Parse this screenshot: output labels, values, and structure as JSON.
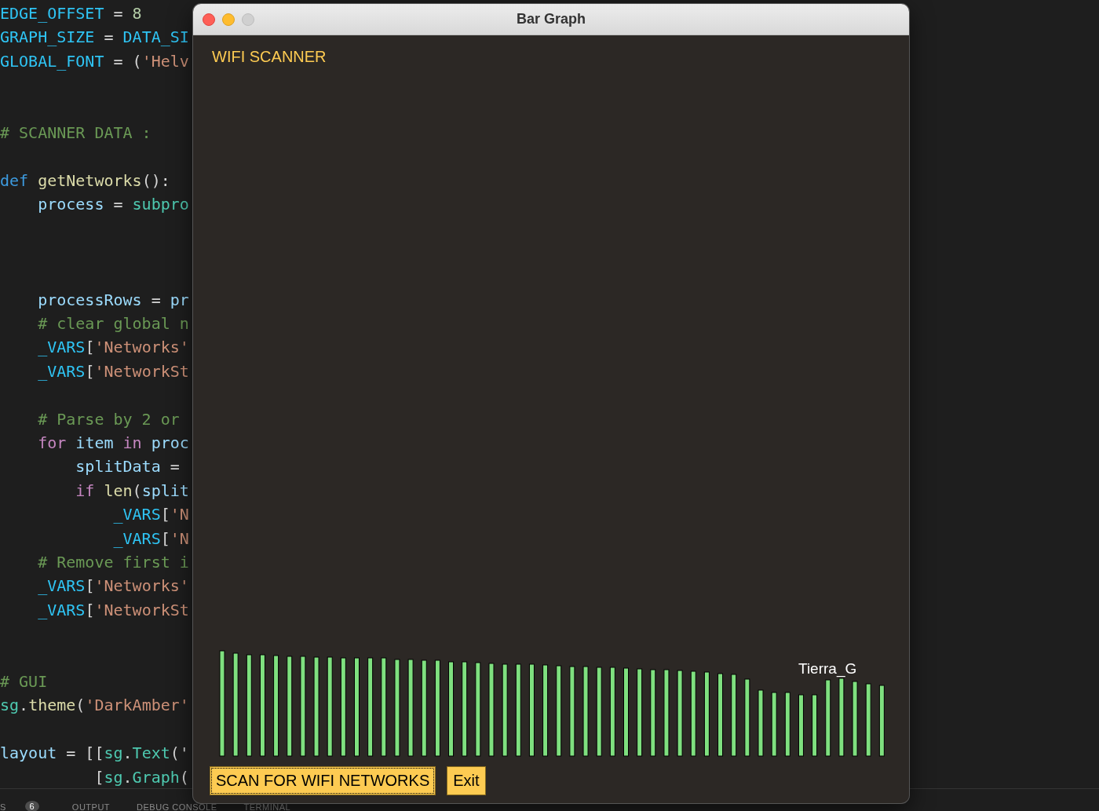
{
  "editor": {
    "lines": [
      {
        "kind": "code",
        "tokens": [
          {
            "text": "EDGE_OFFSET",
            "kind": "const"
          },
          {
            "text": " = ",
            "kind": "plain"
          },
          {
            "text": "8",
            "kind": "number"
          }
        ]
      },
      {
        "kind": "code",
        "tokens": [
          {
            "text": "GRAPH_SIZE",
            "kind": "const"
          },
          {
            "text": " = ",
            "kind": "plain"
          },
          {
            "text": "DATA_SI",
            "kind": "const"
          }
        ]
      },
      {
        "kind": "code",
        "tokens": [
          {
            "text": "GLOBAL_FONT",
            "kind": "const"
          },
          {
            "text": " = (",
            "kind": "plain"
          },
          {
            "text": "'Helv",
            "kind": "string"
          }
        ]
      },
      {
        "kind": "blank"
      },
      {
        "kind": "blank"
      },
      {
        "kind": "code",
        "tokens": [
          {
            "text": "# SCANNER DATA :",
            "kind": "comment"
          }
        ]
      },
      {
        "kind": "blank"
      },
      {
        "kind": "code",
        "tokens": [
          {
            "text": "def",
            "kind": "keyword"
          },
          {
            "text": " getNetworks",
            "kind": "function"
          },
          {
            "text": "():",
            "kind": "plain"
          }
        ]
      },
      {
        "kind": "code",
        "tokens": [
          {
            "text": "    process",
            "kind": "variable"
          },
          {
            "text": " = ",
            "kind": "plain"
          },
          {
            "text": "subpro",
            "kind": "module"
          }
        ]
      },
      {
        "kind": "blank"
      },
      {
        "kind": "blank"
      },
      {
        "kind": "blank"
      },
      {
        "kind": "code",
        "tokens": [
          {
            "text": "    processRows",
            "kind": "variable"
          },
          {
            "text": " = ",
            "kind": "plain"
          },
          {
            "text": "pr",
            "kind": "variable"
          }
        ]
      },
      {
        "kind": "code",
        "tokens": [
          {
            "text": "    # clear global n",
            "kind": "comment"
          }
        ]
      },
      {
        "kind": "code",
        "tokens": [
          {
            "text": "    _VARS",
            "kind": "const"
          },
          {
            "text": "[",
            "kind": "plain"
          },
          {
            "text": "'Networks'",
            "kind": "string"
          }
        ]
      },
      {
        "kind": "code",
        "tokens": [
          {
            "text": "    _VARS",
            "kind": "const"
          },
          {
            "text": "[",
            "kind": "plain"
          },
          {
            "text": "'NetworkSt",
            "kind": "string"
          }
        ]
      },
      {
        "kind": "blank"
      },
      {
        "kind": "code",
        "tokens": [
          {
            "text": "    # Parse by 2 or",
            "kind": "comment"
          }
        ]
      },
      {
        "kind": "code",
        "tokens": [
          {
            "text": "    for",
            "kind": "control"
          },
          {
            "text": " item ",
            "kind": "variable"
          },
          {
            "text": "in",
            "kind": "control"
          },
          {
            "text": " proc",
            "kind": "variable"
          }
        ]
      },
      {
        "kind": "code",
        "tokens": [
          {
            "text": "        splitData",
            "kind": "variable"
          },
          {
            "text": " =",
            "kind": "plain"
          }
        ]
      },
      {
        "kind": "code",
        "tokens": [
          {
            "text": "        if",
            "kind": "control"
          },
          {
            "text": " len",
            "kind": "function"
          },
          {
            "text": "(",
            "kind": "plain"
          },
          {
            "text": "split",
            "kind": "variable"
          }
        ]
      },
      {
        "kind": "code",
        "tokens": [
          {
            "text": "            _VARS",
            "kind": "const"
          },
          {
            "text": "[",
            "kind": "plain"
          },
          {
            "text": "'N",
            "kind": "string"
          }
        ]
      },
      {
        "kind": "code",
        "tokens": [
          {
            "text": "            _VARS",
            "kind": "const"
          },
          {
            "text": "[",
            "kind": "plain"
          },
          {
            "text": "'N",
            "kind": "string"
          }
        ]
      },
      {
        "kind": "code",
        "tokens": [
          {
            "text": "    # Remove first i",
            "kind": "comment"
          }
        ]
      },
      {
        "kind": "code",
        "tokens": [
          {
            "text": "    _VARS",
            "kind": "const"
          },
          {
            "text": "[",
            "kind": "plain"
          },
          {
            "text": "'Networks'",
            "kind": "string"
          }
        ]
      },
      {
        "kind": "code",
        "tokens": [
          {
            "text": "    _VARS",
            "kind": "const"
          },
          {
            "text": "[",
            "kind": "plain"
          },
          {
            "text": "'NetworkSt",
            "kind": "string"
          }
        ]
      },
      {
        "kind": "blank"
      },
      {
        "kind": "blank"
      },
      {
        "kind": "code",
        "tokens": [
          {
            "text": "# GUI",
            "kind": "comment"
          }
        ]
      },
      {
        "kind": "code",
        "tokens": [
          {
            "text": "sg",
            "kind": "module"
          },
          {
            "text": ".",
            "kind": "plain"
          },
          {
            "text": "theme",
            "kind": "function"
          },
          {
            "text": "(",
            "kind": "plain"
          },
          {
            "text": "'DarkAmber'",
            "kind": "string"
          }
        ]
      },
      {
        "kind": "blank"
      },
      {
        "kind": "code",
        "tokens": [
          {
            "text": "layout",
            "kind": "variable"
          },
          {
            "text": " = [[",
            "kind": "plain"
          },
          {
            "text": "sg",
            "kind": "module"
          },
          {
            "text": ".",
            "kind": "plain"
          },
          {
            "text": "Text",
            "kind": "module"
          },
          {
            "text": "('",
            "kind": "plain"
          }
        ]
      },
      {
        "kind": "code",
        "tokens": [
          {
            "text": "          [",
            "kind": "plain"
          },
          {
            "text": "sg",
            "kind": "module"
          },
          {
            "text": ".",
            "kind": "plain"
          },
          {
            "text": "Graph",
            "kind": "module"
          },
          {
            "text": "(",
            "kind": "plain"
          }
        ]
      }
    ]
  },
  "panel": {
    "tabs": [
      {
        "label": "S",
        "kind": "tab"
      },
      {
        "label": "6",
        "kind": "badge"
      },
      {
        "label": "OUTPUT",
        "kind": "tab"
      },
      {
        "label": "DEBUG CONSOLE",
        "kind": "tab"
      },
      {
        "label": "TERMINAL",
        "kind": "tab"
      }
    ]
  },
  "window": {
    "title": "Bar Graph",
    "heading": "WIFI SCANNER",
    "graph": {
      "kind": "picture",
      "label": "Tierra_G"
    },
    "buttons": [
      {
        "label": "SCAN FOR WIFI NETWORKS",
        "focused": true
      },
      {
        "label": "Exit",
        "focused": false
      }
    ]
  }
}
